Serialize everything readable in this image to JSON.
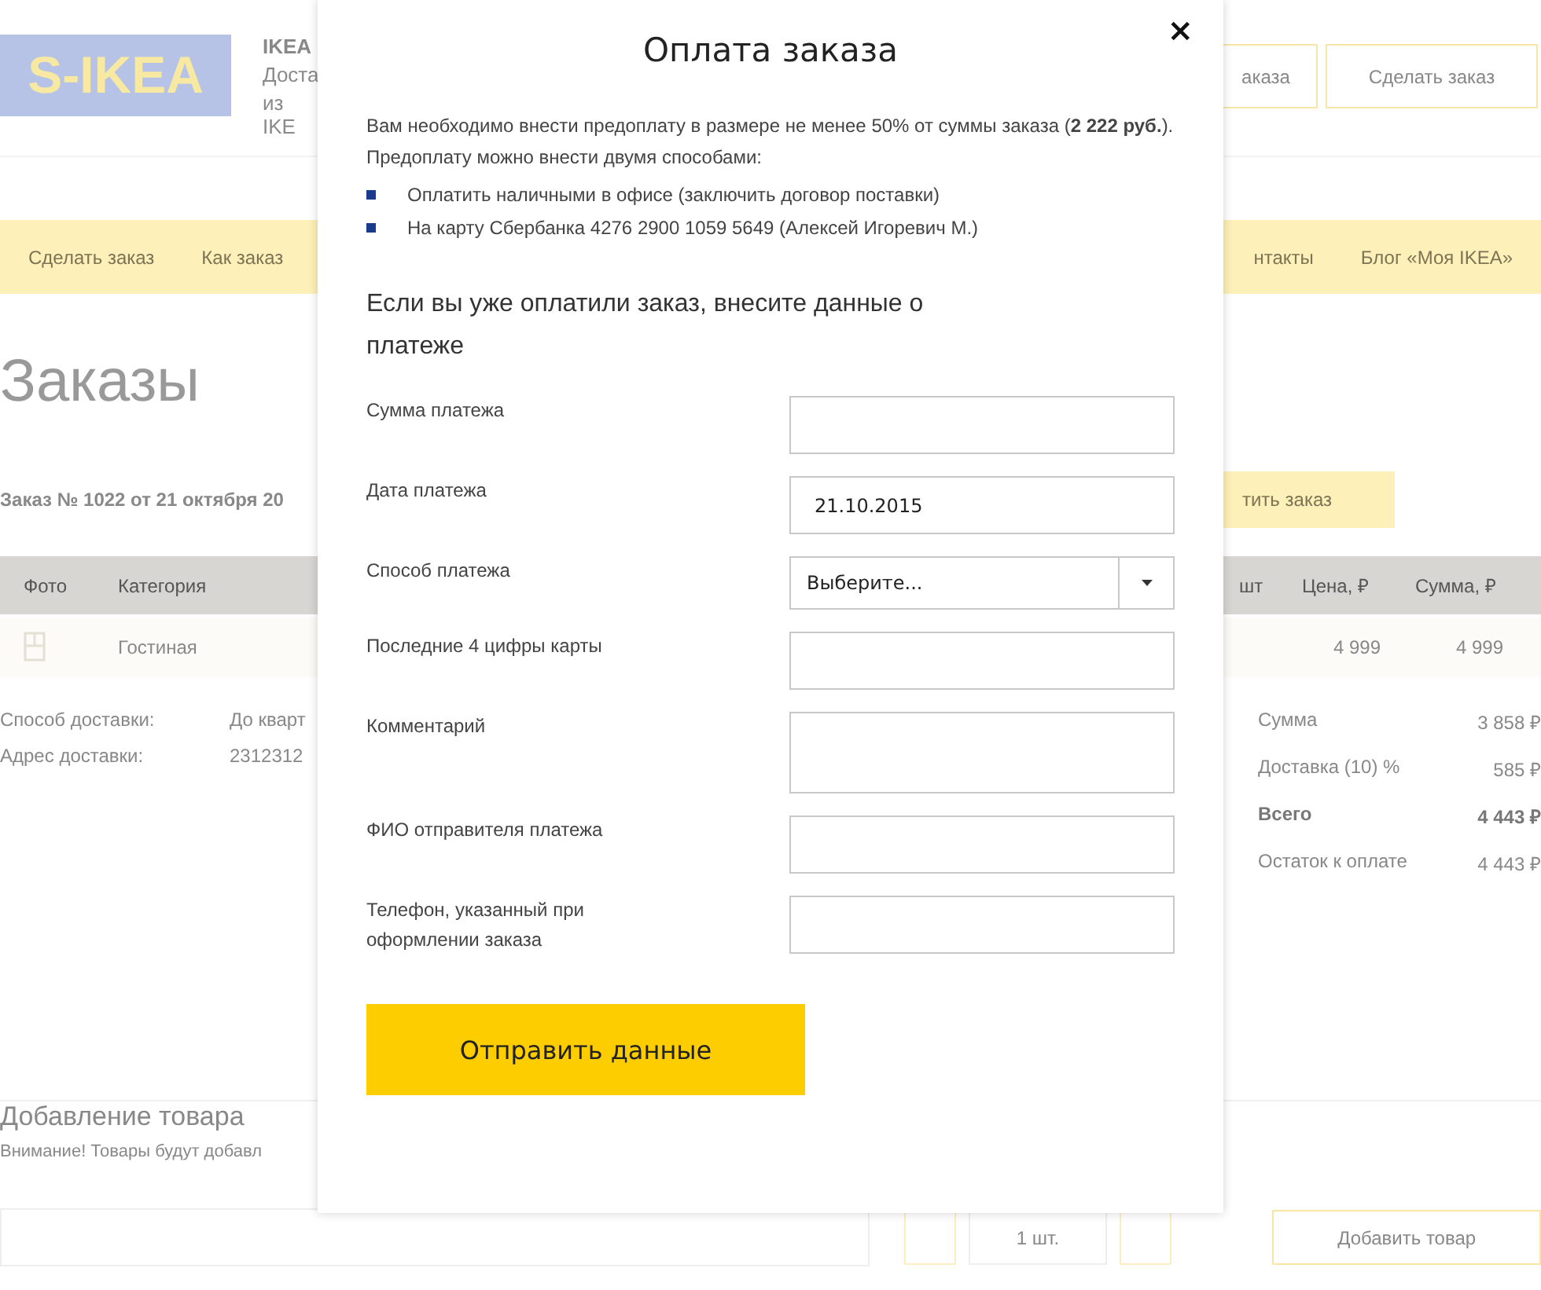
{
  "header": {
    "logo": "S-IKEA",
    "company_name": "IKEA",
    "tagline_lines": [
      "Доста",
      "из IKE"
    ],
    "buttons": [
      "аказа",
      "Сделать заказ"
    ]
  },
  "nav": {
    "items": [
      "Сделать заказ",
      "Как заказ",
      "нтакты",
      "Блог «Моя IKEA»"
    ]
  },
  "page_title": "Заказы",
  "order": {
    "title": "Заказ № 1022 от 21 октября 20",
    "pay_button": "тить заказ"
  },
  "table": {
    "columns": [
      "Фото",
      "Категория",
      "шт",
      "Цена, ₽",
      "Сумма, ₽"
    ],
    "rows": [
      {
        "category": "Гостиная",
        "price": "4 999",
        "sum": "4 999"
      }
    ]
  },
  "delivery": [
    {
      "label": "Способ доставки:",
      "value": "До кварт"
    },
    {
      "label": "Адрес доставки:",
      "value": "2312312"
    }
  ],
  "totals": [
    {
      "label": "Сумма",
      "value": "3 858 ₽",
      "bold": false
    },
    {
      "label": "Доставка (10) %",
      "value": "585 ₽",
      "bold": false
    },
    {
      "label": "Всего",
      "value": "4 443 ₽",
      "bold": true
    },
    {
      "label": "Остаток к оплате",
      "value": "4 443 ₽",
      "bold": false
    }
  ],
  "add_product": {
    "title": "Добавление товара",
    "note": "Внимание! Товары будут добавл",
    "quantity": "1 шт.",
    "button": "Добавить товар"
  },
  "modal": {
    "title": "Оплата заказа",
    "close": "×",
    "intro": "Вам необходимо внести предоплату в размере не менее 50% от суммы заказа (**2 222 руб.**). Предоплату можно внести двумя способами:",
    "methods": [
      "Оплатить наличными в офисе (заключить договор поставки)",
      "На карту Сбербанка 4276 2900 1059 5649 (Алексей Игоревич М.)"
    ],
    "subtitle": "Если вы уже оплатили заказ, внесите данные о платеже",
    "fields": [
      {
        "label": "Сумма платежа",
        "kind": "text"
      },
      {
        "label": "Дата платежа",
        "kind": "text",
        "value": "21.10.2015"
      },
      {
        "label": "Способ платежа",
        "kind": "select",
        "value": "Выберите..."
      },
      {
        "label": "Последние 4 цифры карты",
        "kind": "text"
      },
      {
        "label": "Комментарий",
        "kind": "textarea"
      },
      {
        "label": "ФИО отправителя платежа",
        "kind": "text"
      },
      {
        "label": "Телефон, указанный при оформлении заказа",
        "kind": "text"
      }
    ],
    "submit": "Отправить данные"
  }
}
